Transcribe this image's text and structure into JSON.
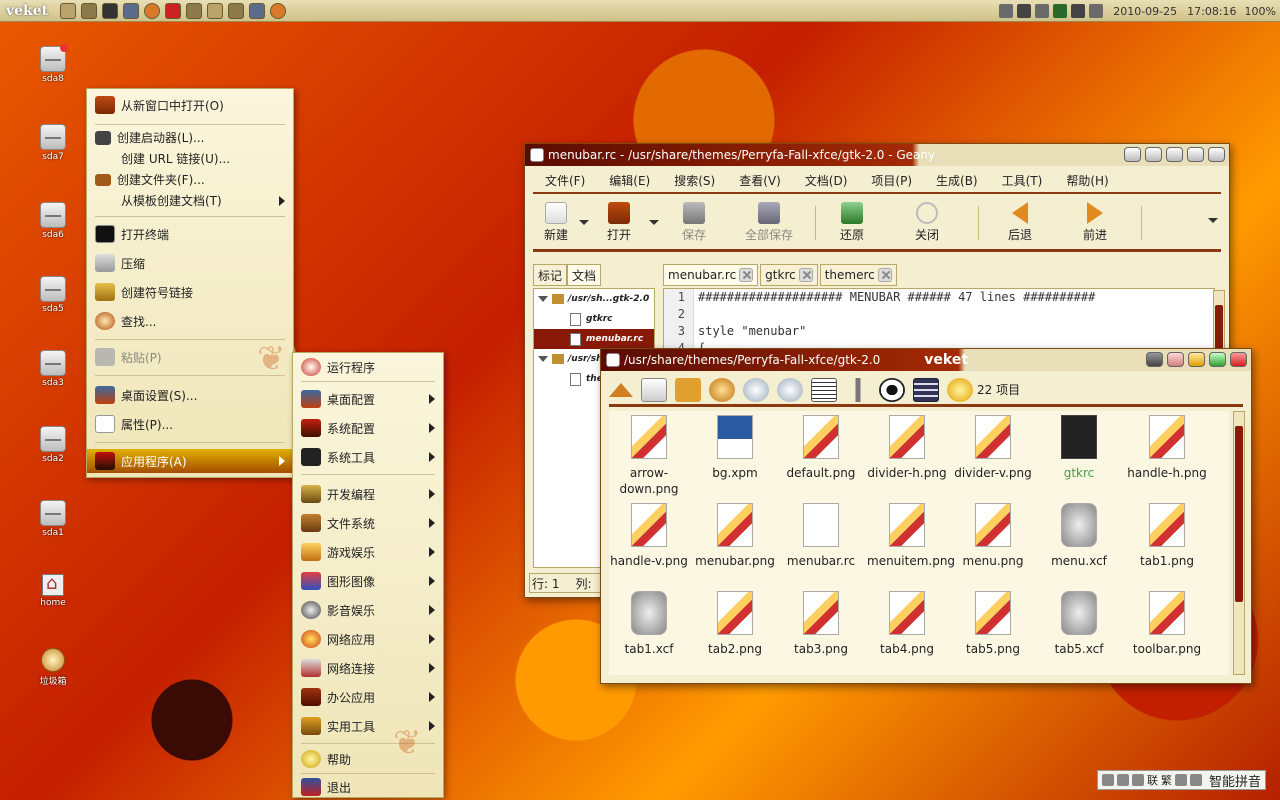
{
  "top_panel": {
    "logo": "veket",
    "launchers": [
      "file-manager-icon",
      "home-icon",
      "terminal-icon",
      "display-icon",
      "browser-icon",
      "mail-icon",
      "settings-icon",
      "paint-icon",
      "folder-icon",
      "screenshot-icon",
      "fire-icon"
    ],
    "date": "2010-09-25",
    "time": "17:08:16",
    "battery": "100%"
  },
  "desktop_icons": [
    {
      "label": "sda8",
      "type": "drive",
      "mounted": true
    },
    {
      "label": "sda7",
      "type": "drive"
    },
    {
      "label": "sda6",
      "type": "drive"
    },
    {
      "label": "sda5",
      "type": "drive"
    },
    {
      "label": "sda3",
      "type": "drive"
    },
    {
      "label": "sda2",
      "type": "drive"
    },
    {
      "label": "sda1",
      "type": "drive"
    },
    {
      "label": "home",
      "type": "home"
    },
    {
      "label": "垃圾箱",
      "type": "trash"
    }
  ],
  "context_menu": {
    "items": [
      {
        "label": "从新窗口中打开(O)",
        "icon": "folder-open-icon"
      },
      {
        "label": "创建启动器(L)...",
        "icon": "launcher-icon"
      },
      {
        "label": "创建 URL 链接(U)...",
        "icon": ""
      },
      {
        "label": "创建文件夹(F)...",
        "icon": "new-folder-icon"
      },
      {
        "label": "从模板创建文档(T)",
        "icon": "",
        "submenu": true
      },
      {
        "label": "打开终端",
        "icon": "terminal-icon"
      },
      {
        "label": "压缩",
        "icon": "archive-icon"
      },
      {
        "label": "创建符号链接",
        "icon": "symlink-icon"
      },
      {
        "label": "查找...",
        "icon": "search-icon"
      },
      {
        "label": "粘贴(P)",
        "icon": "paste-icon",
        "disabled": true
      },
      {
        "label": "桌面设置(S)...",
        "icon": "desktop-settings-icon"
      },
      {
        "label": "属性(P)...",
        "icon": "properties-icon"
      },
      {
        "label": "应用程序(A)",
        "icon": "applications-icon",
        "submenu": true,
        "active": true
      }
    ]
  },
  "apps_menu": {
    "items": [
      {
        "label": "运行程序",
        "icon": "run-icon"
      },
      {
        "label": "桌面配置",
        "icon": "desktop-config-icon",
        "submenu": true
      },
      {
        "label": "系统配置",
        "icon": "system-config-icon",
        "submenu": true
      },
      {
        "label": "系统工具",
        "icon": "system-tools-icon",
        "submenu": true
      },
      {
        "label": "开发编程",
        "icon": "development-icon",
        "submenu": true
      },
      {
        "label": "文件系统",
        "icon": "filesystem-icon",
        "submenu": true
      },
      {
        "label": "游戏娱乐",
        "icon": "games-icon",
        "submenu": true
      },
      {
        "label": "图形图像",
        "icon": "graphics-icon",
        "submenu": true
      },
      {
        "label": "影音娱乐",
        "icon": "multimedia-icon",
        "submenu": true
      },
      {
        "label": "网络应用",
        "icon": "internet-icon",
        "submenu": true
      },
      {
        "label": "网络连接",
        "icon": "network-icon",
        "submenu": true
      },
      {
        "label": "办公应用",
        "icon": "office-icon",
        "submenu": true
      },
      {
        "label": "实用工具",
        "icon": "utilities-icon",
        "submenu": true
      },
      {
        "label": "帮助",
        "icon": "help-icon"
      },
      {
        "label": "退出",
        "icon": "exit-icon"
      }
    ]
  },
  "geany": {
    "title": "menubar.rc - /usr/share/themes/Perryfa-Fall-xfce/gtk-2.0 - Geany",
    "menu": [
      "文件(F)",
      "编辑(E)",
      "搜索(S)",
      "查看(V)",
      "文档(D)",
      "项目(P)",
      "生成(B)",
      "工具(T)",
      "帮助(H)"
    ],
    "toolbar": {
      "new": "新建",
      "open": "打开",
      "save": "保存",
      "save_all": "全部保存",
      "revert": "还原",
      "close": "关闭",
      "back": "后退",
      "forward": "前进"
    },
    "side_tabs": [
      "标记",
      "文档"
    ],
    "tree": [
      {
        "label": "/usr/sh...gtk-2.0",
        "kind": "folder"
      },
      {
        "label": "gtkrc",
        "kind": "file"
      },
      {
        "label": "menubar.rc",
        "kind": "file",
        "selected": true
      },
      {
        "label": "/usr/sh...",
        "kind": "folder"
      },
      {
        "label": "the...",
        "kind": "file"
      }
    ],
    "doc_tabs": [
      "menubar.rc",
      "gtkrc",
      "themerc"
    ],
    "lines": [
      {
        "n": "1",
        "text": "#################### MENUBAR ###### 47 lines ##########"
      },
      {
        "n": "2",
        "text": ""
      },
      {
        "n": "3",
        "text": "style \"menubar\""
      },
      {
        "n": "4",
        "text": "{"
      }
    ],
    "status_line": "行: 1",
    "status_col": "列:"
  },
  "file_manager": {
    "title": "/usr/share/themes/Perryfa-Fall-xfce/gtk-2.0",
    "brand": "veket",
    "item_count": "22 项目",
    "files": [
      {
        "name": "arrow-down.png",
        "kind": "png"
      },
      {
        "name": "bg.xpm",
        "kind": "xpm"
      },
      {
        "name": "default.png",
        "kind": "png"
      },
      {
        "name": "divider-h.png",
        "kind": "png"
      },
      {
        "name": "divider-v.png",
        "kind": "png"
      },
      {
        "name": "gtkrc",
        "kind": "term",
        "dim": true
      },
      {
        "name": "handle-h.png",
        "kind": "png"
      },
      {
        "name": "handle-v.png",
        "kind": "png"
      },
      {
        "name": "menubar.png",
        "kind": "png"
      },
      {
        "name": "menubar.rc",
        "kind": "txt"
      },
      {
        "name": "menuitem.png",
        "kind": "png"
      },
      {
        "name": "menu.png",
        "kind": "png"
      },
      {
        "name": "menu.xcf",
        "kind": "xcf"
      },
      {
        "name": "tab1.png",
        "kind": "png"
      },
      {
        "name": "tab1.xcf",
        "kind": "xcf"
      },
      {
        "name": "tab2.png",
        "kind": "png"
      },
      {
        "name": "tab3.png",
        "kind": "png"
      },
      {
        "name": "tab4.png",
        "kind": "png"
      },
      {
        "name": "tab5.png",
        "kind": "png"
      },
      {
        "name": "tab5.xcf",
        "kind": "xcf"
      },
      {
        "name": "toolbar.png",
        "kind": "png"
      }
    ]
  },
  "ime_bar": {
    "label": "智能拼音",
    "items": [
      "联",
      "繁"
    ]
  }
}
